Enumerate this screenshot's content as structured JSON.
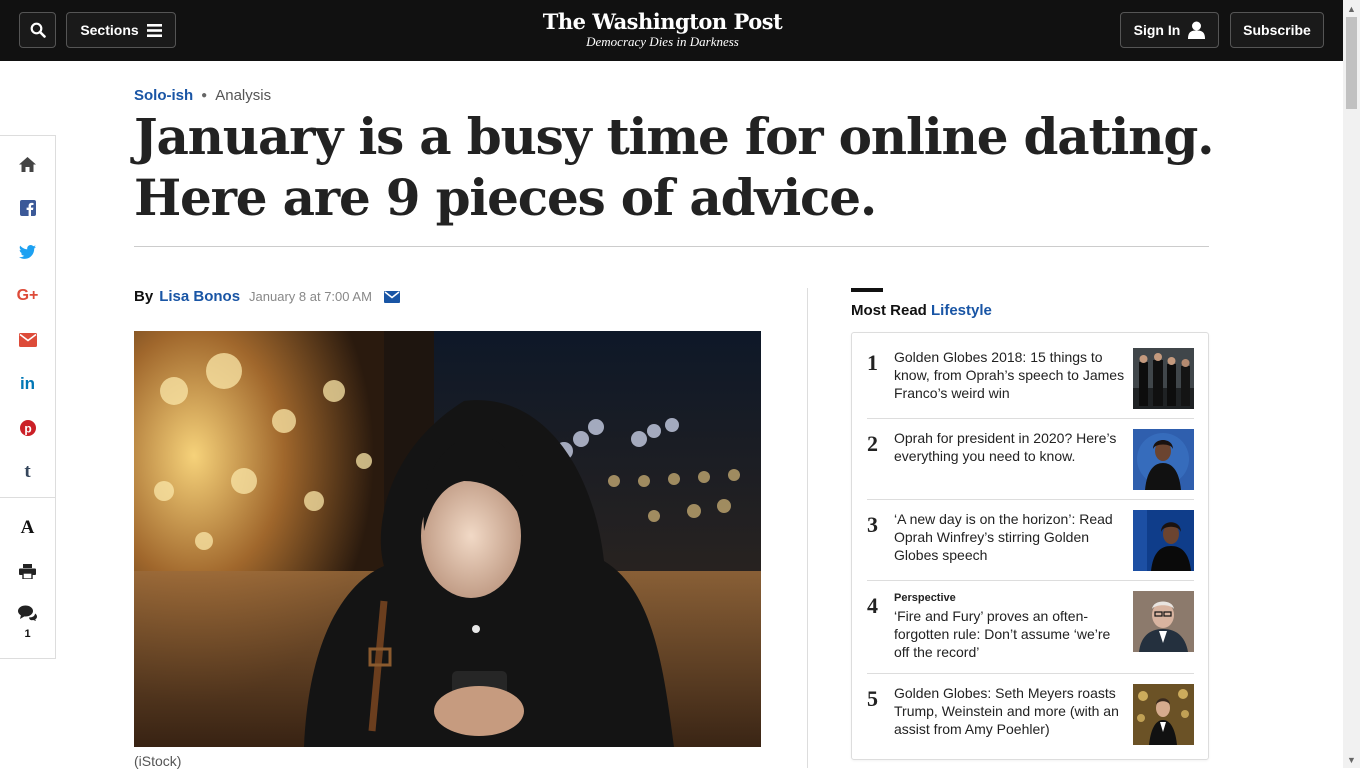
{
  "header": {
    "sections_label": "Sections",
    "brand_name": "The Washington Post",
    "brand_tagline": "Democracy Dies in Darkness",
    "signin_label": "Sign In",
    "subscribe_label": "Subscribe"
  },
  "share_rail": {
    "icons": [
      "home-icon",
      "facebook-icon",
      "twitter-icon",
      "google-plus-icon",
      "email-icon",
      "linkedin-icon",
      "pinterest-icon",
      "tumblr-icon",
      "font-size-icon",
      "print-icon",
      "comments-icon"
    ],
    "comment_count": "1"
  },
  "article": {
    "section": "Solo-ish",
    "label": "Analysis",
    "headline": "January is a busy time for online dating. Here are 9 pieces of advice.",
    "by_label": "By",
    "author": "Lisa Bonos",
    "date": "January 8 at 7:00 AM",
    "image_caption": "(iStock)"
  },
  "most_read": {
    "title_prefix": "Most Read",
    "title_section": "Lifestyle",
    "items": [
      {
        "num": "1",
        "kicker": "",
        "title": "Golden Globes 2018: 15 things to know, from Oprah’s speech to James Franco’s weird win"
      },
      {
        "num": "2",
        "kicker": "",
        "title": "Oprah for president in 2020? Here’s everything you need to know."
      },
      {
        "num": "3",
        "kicker": "",
        "title": "‘A new day is on the horizon’: Read Oprah Winfrey’s stirring Golden Globes speech"
      },
      {
        "num": "4",
        "kicker": "Perspective",
        "title": "‘Fire and Fury’ proves an often-forgotten rule: Don’t assume ‘we’re off the record’"
      },
      {
        "num": "5",
        "kicker": "",
        "title": "Golden Globes: Seth Meyers roasts Trump, Weinstein and more (with an assist from Amy Poehler)"
      }
    ]
  },
  "colors": {
    "topbar": "#111111",
    "link_blue": "#1955a5",
    "facebook": "#3b5998",
    "twitter": "#1da1f2",
    "google_red": "#dd4b39",
    "linkedin": "#0077b5",
    "pinterest": "#cb2027",
    "tumblr": "#35465c"
  }
}
